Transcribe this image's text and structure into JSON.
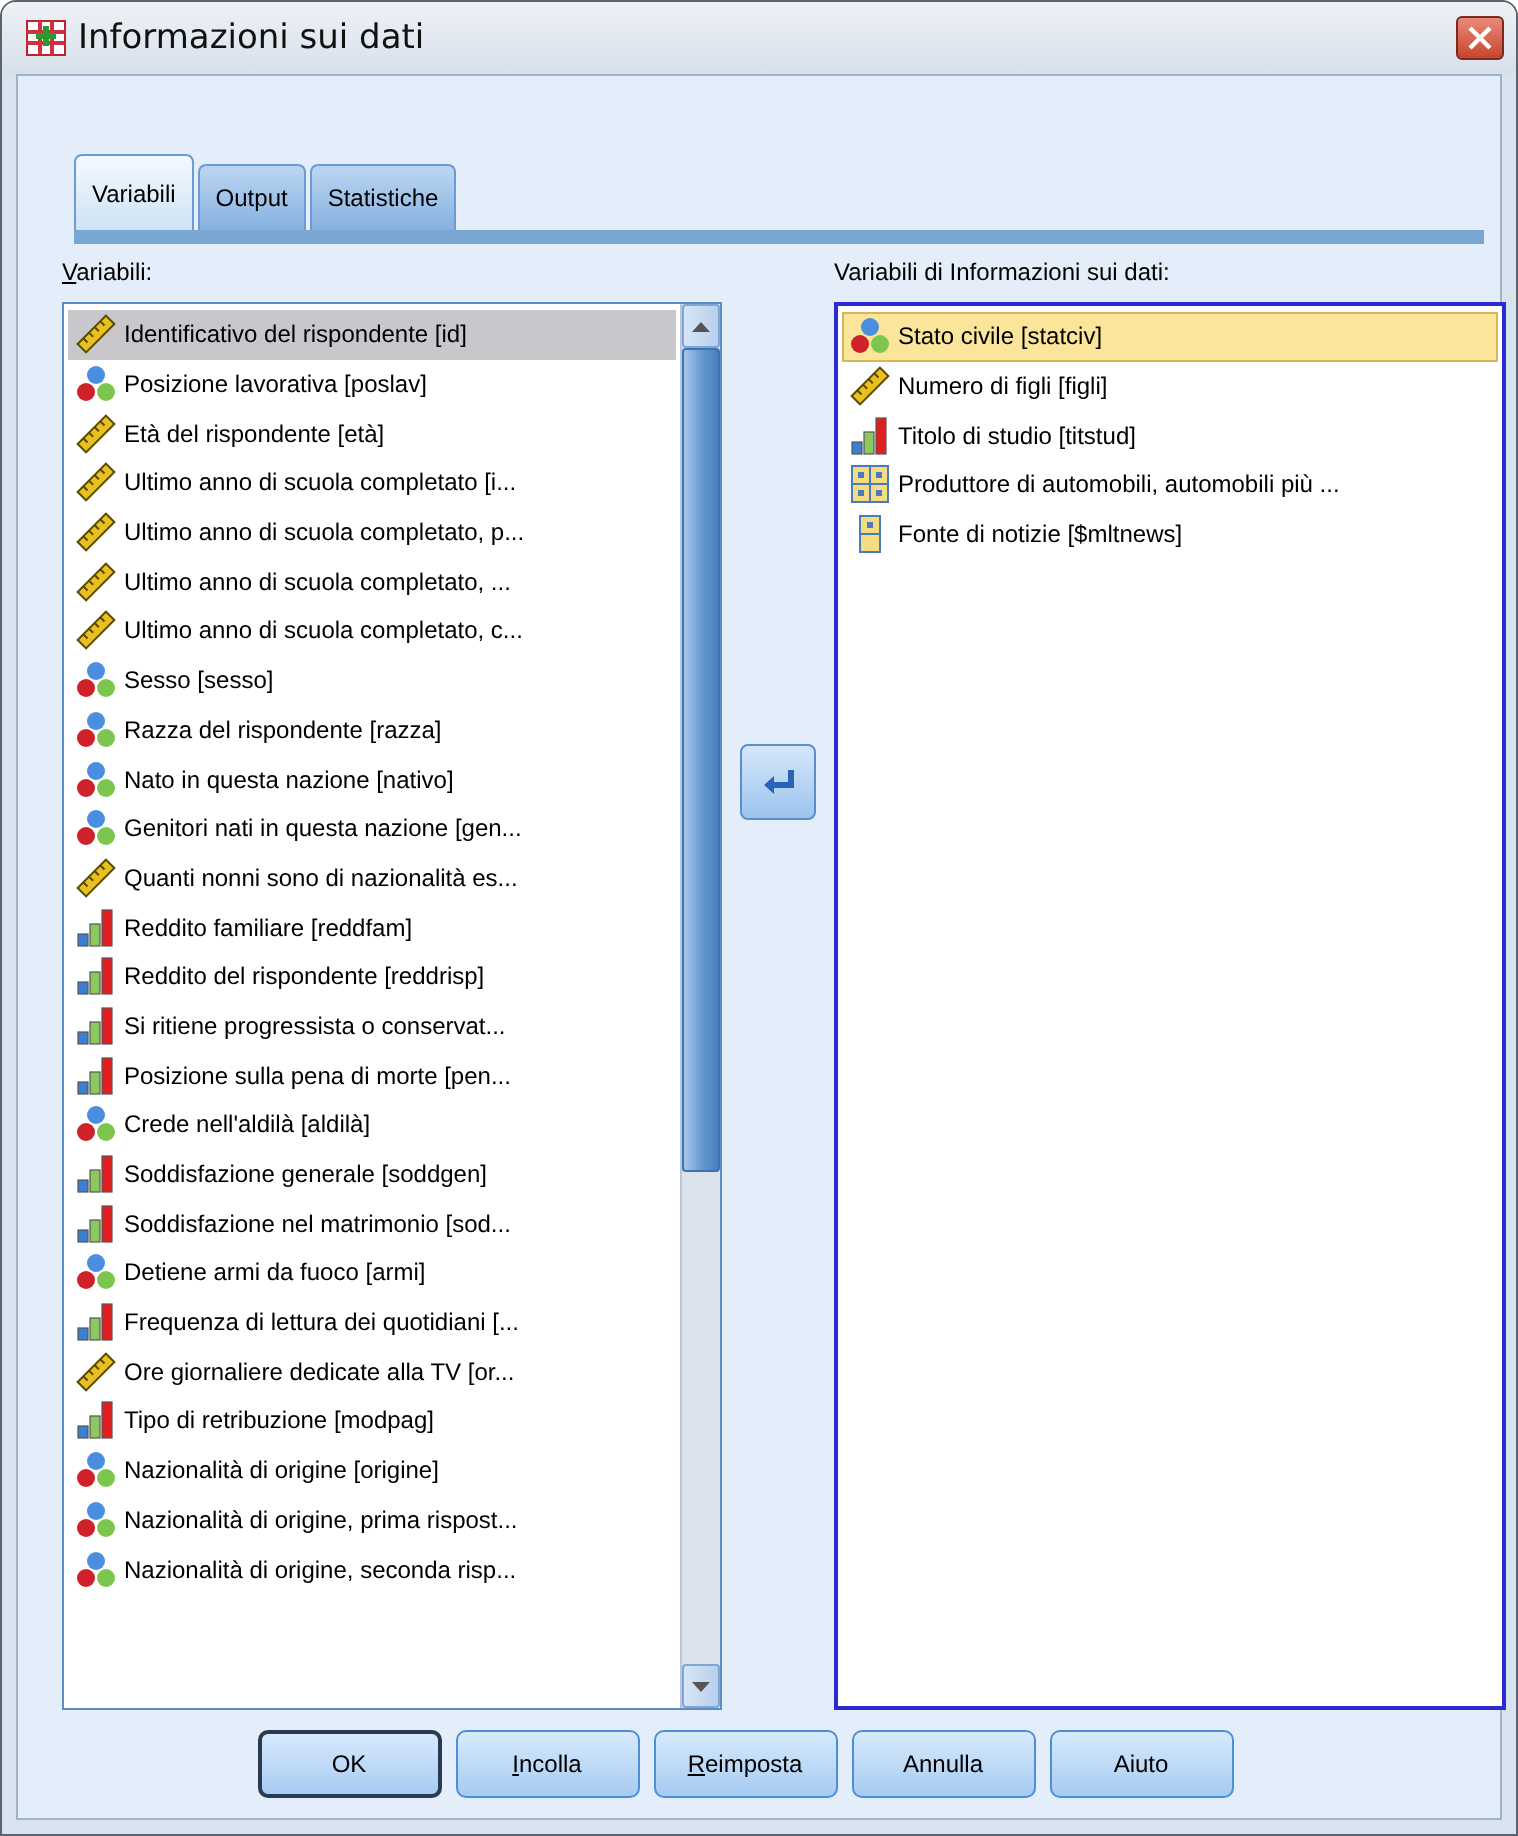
{
  "window": {
    "title": "Informazioni sui dati"
  },
  "tabs": [
    {
      "label": "Variabili",
      "selected": true
    },
    {
      "label": "Output",
      "selected": false
    },
    {
      "label": "Statistiche",
      "selected": false
    }
  ],
  "source_list": {
    "label": "Variabili:",
    "items": [
      {
        "kind": "scale",
        "text": "Identificativo del rispondente [id]",
        "selected": true
      },
      {
        "kind": "nominal",
        "text": "Posizione lavorativa [poslav]",
        "selected": false
      },
      {
        "kind": "scale",
        "text": "Età del rispondente [età]",
        "selected": false
      },
      {
        "kind": "scale",
        "text": "Ultimo anno di scuola completato [i...",
        "selected": false
      },
      {
        "kind": "scale",
        "text": "Ultimo anno di scuola completato, p...",
        "selected": false
      },
      {
        "kind": "scale",
        "text": "Ultimo anno di scuola completato, ...",
        "selected": false
      },
      {
        "kind": "scale",
        "text": "Ultimo anno di scuola completato, c...",
        "selected": false
      },
      {
        "kind": "nominal",
        "text": "Sesso [sesso]",
        "selected": false
      },
      {
        "kind": "nominal",
        "text": "Razza del rispondente [razza]",
        "selected": false
      },
      {
        "kind": "nominal",
        "text": "Nato in questa nazione [nativo]",
        "selected": false
      },
      {
        "kind": "nominal",
        "text": "Genitori nati in questa nazione [gen...",
        "selected": false
      },
      {
        "kind": "scale",
        "text": "Quanti nonni sono di nazionalità es...",
        "selected": false
      },
      {
        "kind": "ordinal",
        "text": "Reddito familiare [reddfam]",
        "selected": false
      },
      {
        "kind": "ordinal",
        "text": "Reddito del rispondente [reddrisp]",
        "selected": false
      },
      {
        "kind": "ordinal",
        "text": "Si ritiene progressista o conservat...",
        "selected": false
      },
      {
        "kind": "ordinal",
        "text": "Posizione sulla pena di morte [pen...",
        "selected": false
      },
      {
        "kind": "nominal",
        "text": "Crede nell'aldilà [aldilà]",
        "selected": false
      },
      {
        "kind": "ordinal",
        "text": "Soddisfazione generale [soddgen]",
        "selected": false
      },
      {
        "kind": "ordinal",
        "text": "Soddisfazione nel matrimonio [sod...",
        "selected": false
      },
      {
        "kind": "nominal",
        "text": "Detiene armi da fuoco [armi]",
        "selected": false
      },
      {
        "kind": "ordinal",
        "text": "Frequenza di lettura dei quotidiani [...",
        "selected": false
      },
      {
        "kind": "scale",
        "text": "Ore giornaliere dedicate alla TV [or...",
        "selected": false
      },
      {
        "kind": "ordinal",
        "text": "Tipo di retribuzione [modpag]",
        "selected": false
      },
      {
        "kind": "nominal",
        "text": "Nazionalità di origine [origine]",
        "selected": false
      },
      {
        "kind": "nominal",
        "text": "Nazionalità di origine, prima rispost...",
        "selected": false
      },
      {
        "kind": "nominal",
        "text": "Nazionalità di origine, seconda risp...",
        "selected": false
      }
    ]
  },
  "target_list": {
    "label": "Variabili di Informazioni sui dati:",
    "items": [
      {
        "kind": "nominal",
        "text": "Stato civile [statciv]",
        "selected": true
      },
      {
        "kind": "scale",
        "text": "Numero di figli [figli]",
        "selected": false
      },
      {
        "kind": "ordinal",
        "text": "Titolo di studio [titstud]",
        "selected": false
      },
      {
        "kind": "set",
        "text": "Produttore di automobili, automobili più ...",
        "selected": false
      },
      {
        "kind": "single_set",
        "text": "Fonte di notizie [$mltnews]",
        "selected": false
      }
    ]
  },
  "buttons": [
    {
      "label": "OK",
      "default": true
    },
    {
      "label": "Incolla",
      "default": false
    },
    {
      "label": "Reimposta",
      "default": false
    },
    {
      "label": "Annulla",
      "default": false
    },
    {
      "label": "Aiuto",
      "default": false
    }
  ]
}
